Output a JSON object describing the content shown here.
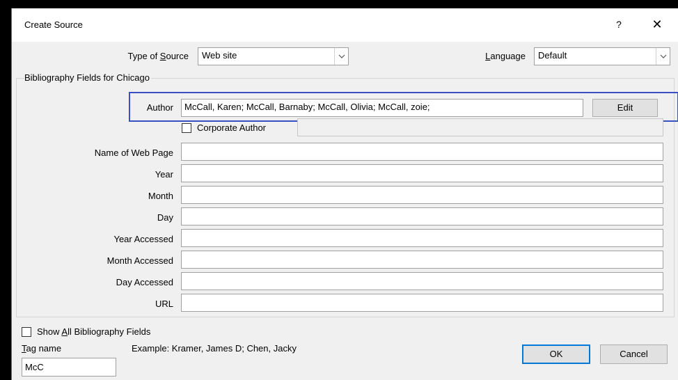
{
  "dialog": {
    "title": "Create Source",
    "help_label": "?",
    "close_label": "✕"
  },
  "source_type": {
    "label_pre": "Type of ",
    "label_accel": "S",
    "label_post": "ource",
    "value": "Web site"
  },
  "language": {
    "label_accel": "L",
    "label_post": "anguage",
    "value": "Default"
  },
  "group_title": "Bibliography Fields for Chicago",
  "author": {
    "label": "Author",
    "value": "McCall, Karen; McCall, Barnaby; McCall, Olivia; McCall, zoie;",
    "edit_label": "Edit"
  },
  "corporate_author": {
    "label": "Corporate Author",
    "checked": false
  },
  "fields": [
    {
      "label": "Name of Web Page",
      "value": ""
    },
    {
      "label": "Year",
      "value": ""
    },
    {
      "label": "Month",
      "value": ""
    },
    {
      "label": "Day",
      "value": ""
    },
    {
      "label": "Year Accessed",
      "value": ""
    },
    {
      "label": "Month Accessed",
      "value": ""
    },
    {
      "label": "Day Accessed",
      "value": ""
    },
    {
      "label": "URL",
      "value": ""
    }
  ],
  "show_all": {
    "label_pre": "Show ",
    "label_accel": "A",
    "label_post": "ll Bibliography Fields",
    "checked": false
  },
  "tag": {
    "label_accel": "T",
    "label_post": "ag name",
    "value": "McC",
    "example": "Example: Kramer, James D; Chen, Jacky"
  },
  "buttons": {
    "ok": "OK",
    "cancel": "Cancel"
  },
  "colors": {
    "highlight": "#3a4fc4",
    "ok_border": "#0078d7"
  }
}
